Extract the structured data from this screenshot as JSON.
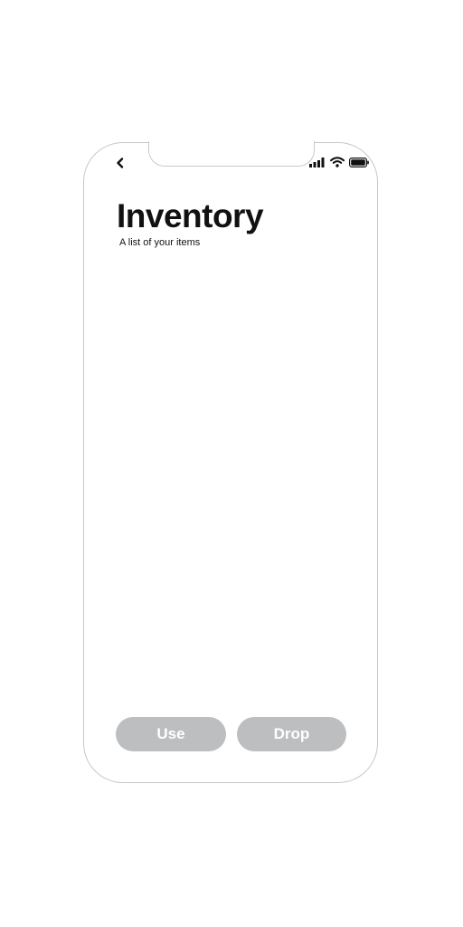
{
  "header": {
    "title": "Inventory",
    "subtitle": "A list of your items"
  },
  "actions": {
    "use_label": "Use",
    "drop_label": "Drop"
  },
  "icons": {
    "back": "chevron-left-icon",
    "signal": "signal-bars-icon",
    "wifi": "wifi-icon",
    "battery": "battery-icon"
  },
  "colors": {
    "text": "#111111",
    "button_background": "#bdbec0",
    "button_text": "#ffffff",
    "frame_border": "#c8c8c8"
  }
}
